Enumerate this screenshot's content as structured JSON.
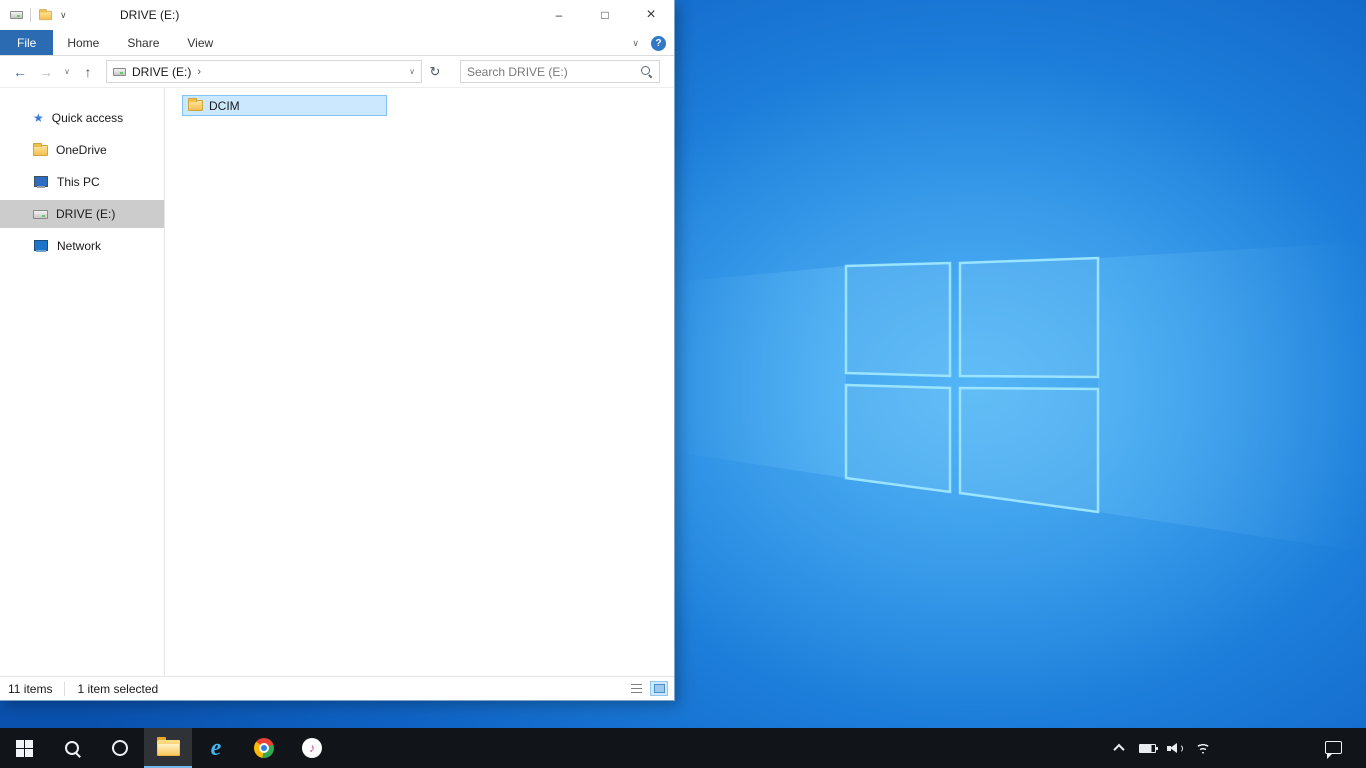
{
  "colors": {
    "file_tab_blue": "#2b6bb2",
    "selection_fill": "#cce8ff",
    "selection_border": "#84c4f5",
    "sidebar_selected_gray": "#cccccc",
    "taskbar_bg": "#11151a",
    "help_circle_blue": "#3079c8",
    "folder_yellow": "#f3c052",
    "desktop_blue": "#1e7fdb",
    "taskbar_active_underline": "#76b9ed"
  },
  "desktop": {
    "wallpaper": "windows-10-hero-logo"
  },
  "explorer": {
    "title": "DRIVE (E:)",
    "titlebar": {
      "qat_dropdown_glyph": "∨",
      "minimize_glyph": "–",
      "maximize_glyph": "□",
      "close_glyph": "×"
    },
    "ribbon": {
      "tabs": [
        {
          "label": "File",
          "active": true
        },
        {
          "label": "Home"
        },
        {
          "label": "Share"
        },
        {
          "label": "View"
        }
      ],
      "collapse_glyph": "∨",
      "help_glyph": "?"
    },
    "navigation": {
      "back_glyph": "←",
      "forward_glyph": "→",
      "recent_glyph": "∨",
      "up_glyph": "↑",
      "crumb": "DRIVE (E:)",
      "crumb_chevron": "›",
      "address_dropdown_glyph": "∨",
      "refresh_glyph": "↻",
      "search_placeholder": "Search DRIVE (E:)"
    },
    "sidebar": [
      {
        "label": "Quick access",
        "glyph": "★",
        "icon": "star-icon"
      },
      {
        "label": "OneDrive",
        "icon": "onedrive-folder-icon"
      },
      {
        "label": "This PC",
        "icon": "computer-icon"
      },
      {
        "label": "DRIVE (E:)",
        "icon": "drive-icon",
        "selected": true
      },
      {
        "label": "Network",
        "icon": "network-icon"
      }
    ],
    "files": [
      {
        "name": "DCIM",
        "icon": "folder-icon",
        "selected": true
      }
    ],
    "statusbar": {
      "item_count": "11 items",
      "selection_count": "1 item selected",
      "view_toggles": [
        "details-view",
        "large-icons-view"
      ]
    }
  },
  "taskbar": {
    "buttons": [
      {
        "name": "start",
        "icon": "windows-logo-icon"
      },
      {
        "name": "search",
        "icon": "search-icon"
      },
      {
        "name": "cortana",
        "icon": "cortana-circle-icon"
      },
      {
        "name": "file-explorer",
        "icon": "folder-icon",
        "active": true
      },
      {
        "name": "internet-explorer",
        "icon": "ie-icon",
        "glyph": "e"
      },
      {
        "name": "chrome",
        "icon": "chrome-icon"
      },
      {
        "name": "itunes",
        "icon": "itunes-icon",
        "glyph": "♪"
      }
    ],
    "tray": [
      {
        "name": "show-hidden-icons",
        "icon": "chevron-up-icon"
      },
      {
        "name": "battery",
        "icon": "battery-icon"
      },
      {
        "name": "volume",
        "icon": "speaker-icon"
      },
      {
        "name": "network",
        "icon": "wifi-icon"
      },
      {
        "name": "action-center",
        "icon": "action-center-icon"
      }
    ]
  }
}
